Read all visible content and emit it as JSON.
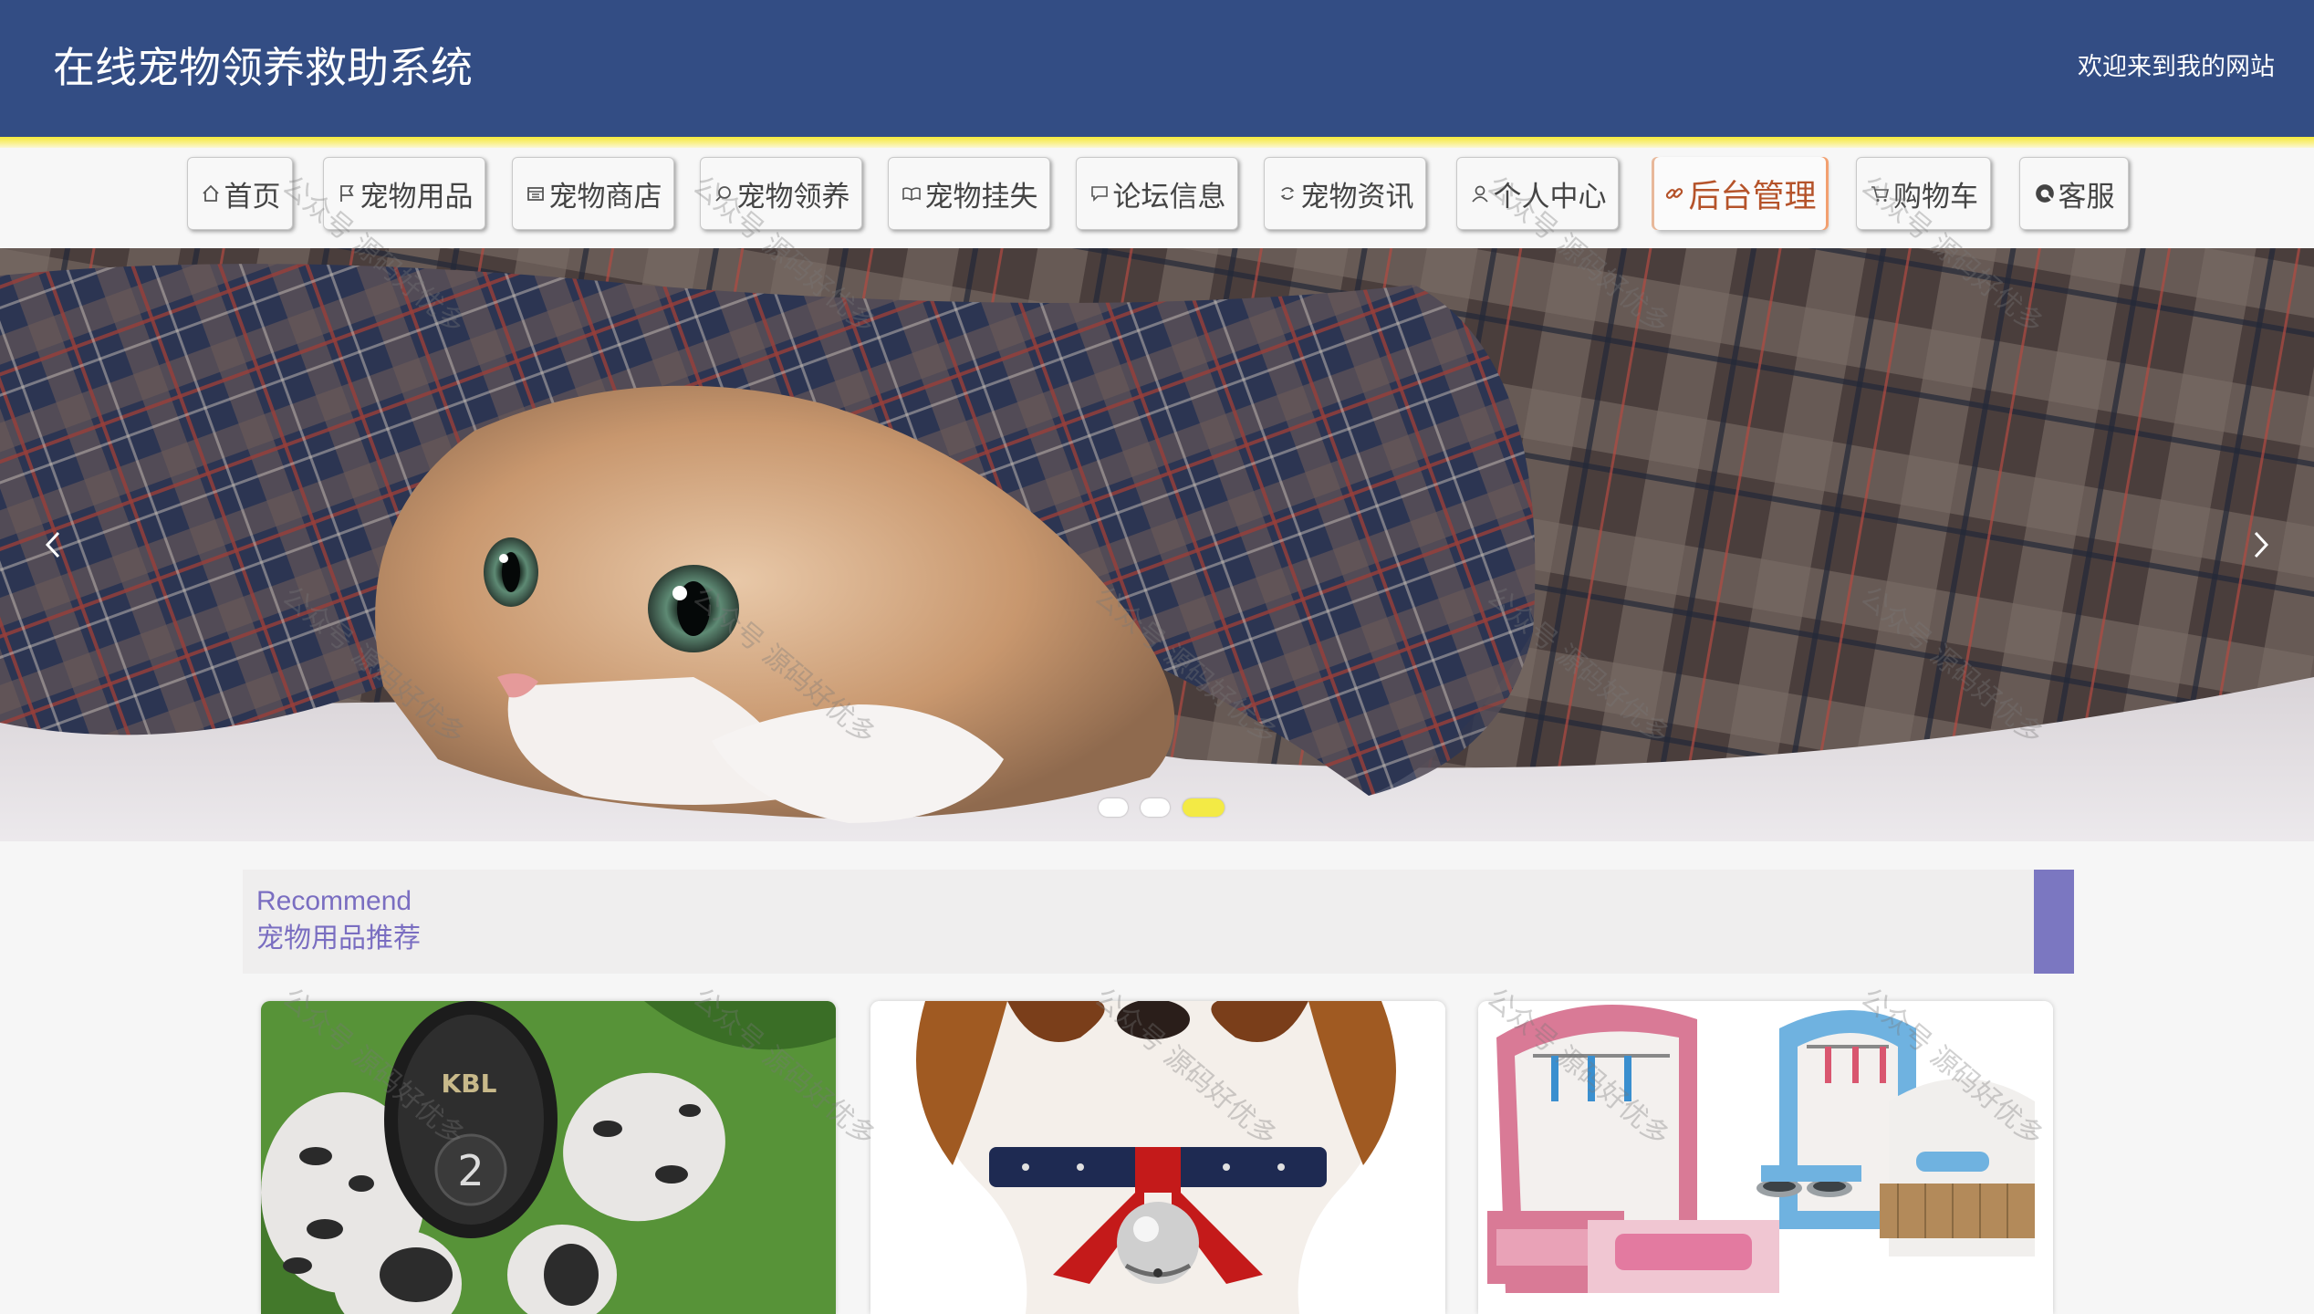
{
  "header": {
    "title": "在线宠物领养救助系统",
    "welcome": "欢迎来到我的网站",
    "bg_color": "#334d84",
    "accent_color": "#f6ea3c"
  },
  "nav": {
    "items": [
      {
        "label": "首页",
        "icon": "home-icon"
      },
      {
        "label": "宠物用品",
        "icon": "flag-icon"
      },
      {
        "label": "宠物商店",
        "icon": "store-icon"
      },
      {
        "label": "宠物领养",
        "icon": "search-icon"
      },
      {
        "label": "宠物挂失",
        "icon": "book-icon"
      },
      {
        "label": "论坛信息",
        "icon": "chat-icon"
      },
      {
        "label": "宠物资讯",
        "icon": "news-icon"
      },
      {
        "label": "个人中心",
        "icon": "user-icon"
      },
      {
        "label": "后台管理",
        "icon": "link-icon",
        "active": true
      },
      {
        "label": "购物车",
        "icon": "cart-icon"
      },
      {
        "label": "客服",
        "icon": "service-icon"
      }
    ],
    "active_color": "#b5532a"
  },
  "banner": {
    "image": "kitten hiding under plaid blanket",
    "prev_icon": "chevron-left-icon",
    "next_icon": "chevron-right-icon",
    "slide_count": 3,
    "active_slide": 3,
    "active_dot_color": "#f3ea45"
  },
  "recommend": {
    "title_en": "Recommend",
    "title_cn": "宠物用品推荐",
    "accent_color": "#7b77c1",
    "text_color": "#7a6ec1",
    "products": [
      {
        "image": "dog shoes with paw sole"
      },
      {
        "image": "dog with red bow and bell collar"
      },
      {
        "image": "pet wardrobe and bed furniture set"
      }
    ]
  },
  "watermark": {
    "text": "公众号 源码好优多"
  }
}
